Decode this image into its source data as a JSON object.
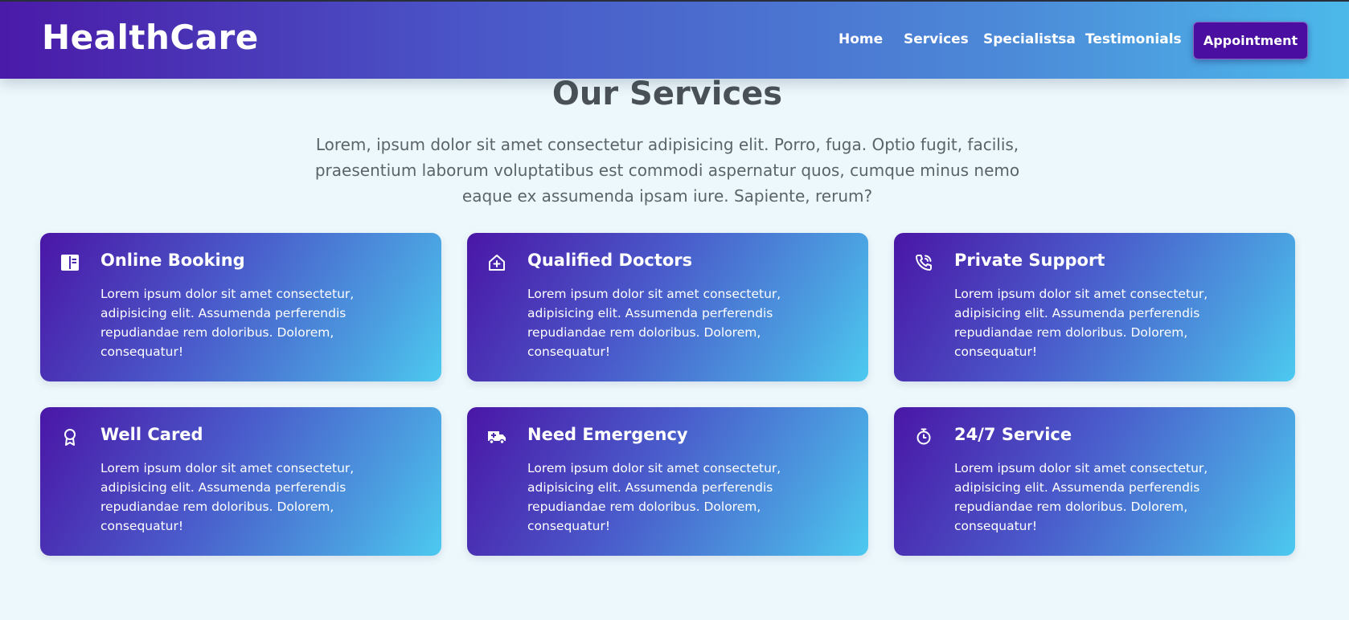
{
  "header": {
    "logo": "HealthCare",
    "nav": [
      {
        "label": "Home"
      },
      {
        "label": "Services"
      },
      {
        "label": "Specialistsa"
      },
      {
        "label": "Testimonials"
      }
    ],
    "cta_label": "Appointment"
  },
  "services": {
    "title": "Our Services",
    "intro": "Lorem, ipsum dolor sit amet consectetur adipisicing elit. Porro, fuga. Optio fugit, facilis, praesentium laborum voluptatibus est commodi aspernatur quos, cumque minus nemo eaque ex assumenda ipsam iure. Sapiente, rerum?",
    "cards": [
      {
        "icon": "book-icon",
        "title": "Online Booking",
        "text": "Lorem ipsum dolor sit amet consectetur, adipisicing elit. Assumenda perferendis repudiandae rem doloribus. Dolorem, consequatur!"
      },
      {
        "icon": "house-medical-icon",
        "title": "Qualified Doctors",
        "text": "Lorem ipsum dolor sit amet consectetur, adipisicing elit. Assumenda perferendis repudiandae rem doloribus. Dolorem, consequatur!"
      },
      {
        "icon": "phone-icon",
        "title": "Private Support",
        "text": "Lorem ipsum dolor sit amet consectetur, adipisicing elit. Assumenda perferendis repudiandae rem doloribus. Dolorem, consequatur!"
      },
      {
        "icon": "award-icon",
        "title": "Well Cared",
        "text": "Lorem ipsum dolor sit amet consectetur, adipisicing elit. Assumenda perferendis repudiandae rem doloribus. Dolorem, consequatur!"
      },
      {
        "icon": "ambulance-icon",
        "title": "Need Emergency",
        "text": "Lorem ipsum dolor sit amet consectetur, adipisicing elit. Assumenda perferendis repudiandae rem doloribus. Dolorem, consequatur!"
      },
      {
        "icon": "stopwatch-icon",
        "title": "24/7 Service",
        "text": "Lorem ipsum dolor sit amet consectetur, adipisicing elit. Assumenda perferendis repudiandae rem doloribus. Dolorem, consequatur!"
      }
    ]
  },
  "colors": {
    "header_start": "#4a1aa8",
    "header_end": "#4cb9ea",
    "cta_bg": "#4a0fa0",
    "page_bg": "#edf8fc",
    "title_text": "#4a5257"
  }
}
